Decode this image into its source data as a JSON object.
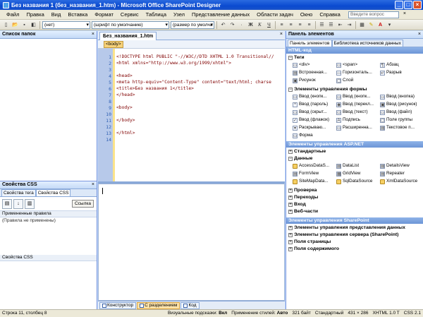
{
  "window": {
    "title": "Без названия 1 (без_названия_1.htm) - Microsoft Office SharePoint Designer",
    "controls": [
      "_",
      "□",
      "×"
    ]
  },
  "menu": {
    "items": [
      "Файл",
      "Правка",
      "Вид",
      "Вставка",
      "Формат",
      "Сервис",
      "Таблица",
      "Узел",
      "Представление данных",
      "Области задач",
      "Окно",
      "Справка"
    ],
    "help_placeholder": "Введите вопрос",
    "help_close": "×"
  },
  "toolbar": {
    "style_select": "(нет)",
    "font_select": "(шрифт по умолчанию)",
    "size_select": "(размер по умолча",
    "bold": "Ж",
    "italic": "К",
    "underline": "Ч"
  },
  "folder_pane": {
    "title": "Список папок",
    "close": "×"
  },
  "css_pane": {
    "title": "Свойства CSS",
    "close": "×",
    "tabs": [
      "Свойства тега",
      "Свойства CSS"
    ],
    "link_button": "Ссылка",
    "applied_rules_header": "Примененные правила",
    "applied_rules_text": "(Правила не применены)",
    "css_props_header": "Свойства CSS"
  },
  "document": {
    "tab_label": "Без_названия_1.htm",
    "tab_close": "×",
    "tag_selector": "<body>",
    "line_numbers": [
      "1",
      "2",
      "3",
      "4",
      "5",
      "6",
      "7",
      "8",
      "9",
      "10",
      "11",
      "12",
      "13",
      "14"
    ],
    "code_lines": [
      {
        "n": 1,
        "tag": "<!DOCTYPE html PUBLIC \"-//W3C//DTD XHTML 1.0 Transitional//"
      },
      {
        "n": 2,
        "tag": "<html xmlns=\"http://www.w3.org/1999/xhtml\">"
      },
      {
        "n": 4,
        "tag": "<head>"
      },
      {
        "n": 5,
        "tag": "<meta http-equiv=\"Content-Type\" content=\"text/html; charse"
      },
      {
        "n": 6,
        "tag": "<title>Без названия 1</title>"
      },
      {
        "n": 7,
        "tag": "</head>"
      },
      {
        "n": 9,
        "tag": "<body>"
      },
      {
        "n": 11,
        "tag": "</body>"
      },
      {
        "n": 13,
        "tag": "</html>"
      }
    ],
    "view_tabs": [
      "Конструктор",
      "С разделением",
      "Код"
    ]
  },
  "toolbox": {
    "title": "Панель элементов",
    "close": "×",
    "tabs": [
      "Панель элементов",
      "Библиотека источников данных"
    ],
    "html_category": "HTML-код",
    "tags_group": "Теги",
    "tags_items": [
      "<div>",
      "<span>",
      "Абзац",
      "Встроенная...",
      "Горизонталь...",
      "Разрыв",
      "Рисунок",
      "Слой"
    ],
    "form_group": "Элементы управления формы",
    "form_items": [
      "Ввод (кнопк...",
      "Ввод (кнопк...",
      "Ввод (кнопка)",
      "Ввод (пароль)",
      "Ввод (перекл...",
      "Ввод (рисунок)",
      "Ввод (скрыт...",
      "Ввод (текст)",
      "Ввод (файл)",
      "Ввод (флажок)",
      "Подпись",
      "Поле группы",
      "Раскрываю...",
      "Расширенна...",
      "Текстовое п...",
      "Форма"
    ],
    "aspnet_category": "Элементы управления ASP.NET",
    "standard_group": "Стандартные",
    "data_group": "Данные",
    "data_items": [
      "AccessDataS...",
      "DataList",
      "DetailsView",
      "FormView",
      "GridView",
      "Repeater",
      "SiteMapData...",
      "SqlDataSource",
      "XmlDataSource"
    ],
    "other_groups": [
      "Проверка",
      "Переходы",
      "Вход",
      "Веб-части"
    ],
    "sharepoint_category": "Элементы управления SharePoint",
    "sharepoint_groups": [
      "Элементы управления представления данных",
      "Элементы управления сервера (SharePoint)",
      "Поля страницы",
      "Поля содержимого"
    ]
  },
  "status": {
    "position": "Строка 11, столбец 8",
    "visual_aids_label": "Визуальные подсказки:",
    "visual_aids_value": "Вкл",
    "style_apply_label": "Применение стилей:",
    "style_apply_value": "Авто",
    "size": "321 байт",
    "mode": "Стандартный",
    "dimensions": "431 × 286",
    "doctype": "XHTML 1.0 T",
    "css_version": "CSS 2.1"
  }
}
